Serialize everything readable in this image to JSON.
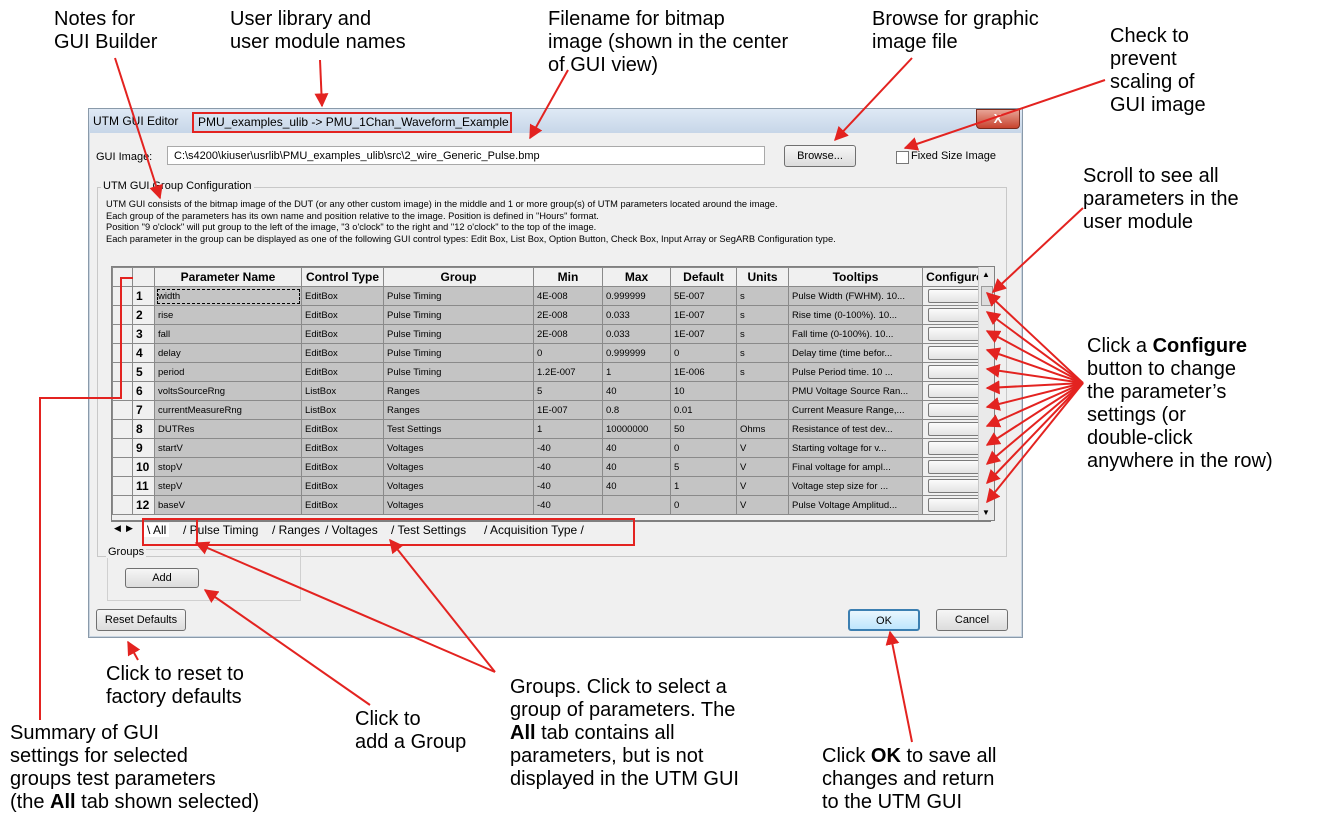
{
  "callouts": {
    "notes": [
      "Notes for",
      "GUI Builder"
    ],
    "user_library": [
      "User library and",
      "user module names"
    ],
    "filename": [
      "Filename for bitmap",
      "image (shown in the center",
      "of GUI view)"
    ],
    "browse": [
      "Browse for graphic",
      "image file"
    ],
    "fixed_size": [
      "Check to",
      "prevent",
      "scaling of",
      "GUI image"
    ],
    "scroll": [
      "Scroll to see all",
      "parameters in the",
      "user module"
    ],
    "configure": {
      "line1_pre": "Click a ",
      "line1_bold": "Configure",
      "rest": [
        "button to change",
        "the parameter’s",
        "settings (or",
        "double-click",
        "anywhere in the row)"
      ]
    },
    "reset": [
      "Click to reset to",
      "factory defaults"
    ],
    "add_group": [
      "Click to",
      "add a Group"
    ],
    "summary": {
      "lines": [
        "Summary of GUI",
        "settings for selected",
        "groups test parameters"
      ],
      "last_pre": "(the ",
      "last_bold": "All",
      "last_post": " tab shown selected)"
    },
    "groups": {
      "lines": [
        "Groups. Click to select a",
        "group of parameters. The"
      ],
      "bold": "All",
      "line3_post": " tab contains all",
      "more": [
        "parameters, but is not",
        "displayed in the UTM GUI"
      ]
    },
    "ok": {
      "pre": "Click ",
      "bold": "OK",
      "post": " to save all",
      "more": [
        "changes and return",
        "to the UTM GUI"
      ]
    }
  },
  "window": {
    "title": "UTM GUI Editor",
    "module_path": "PMU_examples_ulib  ->  PMU_1Chan_Waveform_Example",
    "close_label": "X",
    "gui_image_label": "GUI Image:",
    "gui_image_value": "C:\\s4200\\kiuser\\usrlib\\PMU_examples_ulib\\src\\2_wire_Generic_Pulse.bmp",
    "browse_label": "Browse...",
    "fixed_size_label": "Fixed Size Image",
    "group_config_label": "UTM GUI Group Configuration",
    "description": [
      "UTM GUI consists of the bitmap image of the DUT (or any other custom image) in the middle and 1 or more group(s) of UTM parameters located around the image.",
      "Each group of the parameters has its own name and position relative to the image. Position is defined in \"Hours\" format.",
      "Position \"9 o'clock\" will put group to the left of the image, \"3 o'clock\" to the right and \"12 o'clock\" to the top of the image.",
      "Each parameter in the group can be displayed as one of the following GUI control types: Edit Box, List Box, Option Button, Check Box, Input Array or SegARB Configuration type."
    ],
    "columns": [
      "Parameter Name",
      "Control Type",
      "Group",
      "Min",
      "Max",
      "Default",
      "Units",
      "Tooltips",
      "Configure"
    ],
    "rows": [
      {
        "n": "1",
        "name": "width",
        "ctrl": "EditBox",
        "group": "Pulse Timing",
        "min": "4E-008",
        "max": "0.999999",
        "def": "5E-007",
        "units": "s",
        "tip": "Pulse Width (FWHM). 10..."
      },
      {
        "n": "2",
        "name": "rise",
        "ctrl": "EditBox",
        "group": "Pulse Timing",
        "min": "2E-008",
        "max": "0.033",
        "def": "1E-007",
        "units": "s",
        "tip": "Rise time (0-100%). 10..."
      },
      {
        "n": "3",
        "name": "fall",
        "ctrl": "EditBox",
        "group": "Pulse Timing",
        "min": "2E-008",
        "max": "0.033",
        "def": "1E-007",
        "units": "s",
        "tip": "Fall time (0-100%). 10..."
      },
      {
        "n": "4",
        "name": "delay",
        "ctrl": "EditBox",
        "group": "Pulse Timing",
        "min": "0",
        "max": "0.999999",
        "def": "0",
        "units": "s",
        "tip": "Delay time (time befor..."
      },
      {
        "n": "5",
        "name": "period",
        "ctrl": "EditBox",
        "group": "Pulse Timing",
        "min": "1.2E-007",
        "max": "1",
        "def": "1E-006",
        "units": "s",
        "tip": "Pulse Period time. 10 ..."
      },
      {
        "n": "6",
        "name": "voltsSourceRng",
        "ctrl": "ListBox",
        "group": "Ranges",
        "min": "5",
        "max": "40",
        "def": "10",
        "units": "",
        "tip": "PMU Voltage Source Ran..."
      },
      {
        "n": "7",
        "name": "currentMeasureRng",
        "ctrl": "ListBox",
        "group": "Ranges",
        "min": "1E-007",
        "max": "0.8",
        "def": "0.01",
        "units": "",
        "tip": "Current Measure Range,..."
      },
      {
        "n": "8",
        "name": "DUTRes",
        "ctrl": "EditBox",
        "group": "Test Settings",
        "min": "1",
        "max": "10000000",
        "def": "50",
        "units": "Ohms",
        "tip": "Resistance of test dev..."
      },
      {
        "n": "9",
        "name": "startV",
        "ctrl": "EditBox",
        "group": "Voltages",
        "min": "-40",
        "max": "40",
        "def": "0",
        "units": "V",
        "tip": "Starting voltage for v..."
      },
      {
        "n": "10",
        "name": "stopV",
        "ctrl": "EditBox",
        "group": "Voltages",
        "min": "-40",
        "max": "40",
        "def": "5",
        "units": "V",
        "tip": "Final voltage for ampl..."
      },
      {
        "n": "11",
        "name": "stepV",
        "ctrl": "EditBox",
        "group": "Voltages",
        "min": "-40",
        "max": "40",
        "def": "1",
        "units": "V",
        "tip": "Voltage step size for ..."
      },
      {
        "n": "12",
        "name": "baseV",
        "ctrl": "EditBox",
        "group": "Voltages",
        "min": "-40",
        "max": "",
        "def": "0",
        "units": "V",
        "tip": "Pulse Voltage Amplitud..."
      }
    ],
    "tabs": [
      "All",
      "Pulse Timing",
      "Ranges",
      "Voltages",
      "Test Settings",
      "Acquisition Type"
    ],
    "groups_label": "Groups",
    "add_label": "Add",
    "reset_label": "Reset Defaults",
    "ok_label": "OK",
    "cancel_label": "Cancel"
  },
  "colors": {
    "annotation": "#e32320",
    "grid_cell": "#c4c4c4",
    "window_bg": "#f0f0f0"
  }
}
